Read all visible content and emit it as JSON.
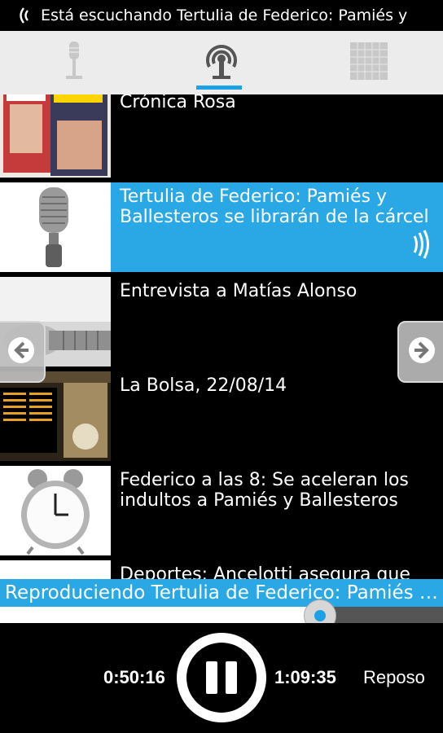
{
  "status": {
    "text": "Está escuchando Tertulia de Federico: Pamiés y",
    "icon": "broadcast-waves-icon"
  },
  "tabs": [
    {
      "name": "microphone-tab",
      "icon": "microphone-icon",
      "selected": false
    },
    {
      "name": "podcast-tab",
      "icon": "podcast-icon",
      "selected": true
    },
    {
      "name": "calendar-tab",
      "icon": "calendar-icon",
      "selected": false
    }
  ],
  "list": {
    "items": [
      {
        "title": "Crónica Rosa",
        "thumb": "magazines"
      },
      {
        "title": "Tertulia de Federico: Pamiés y Ballesteros se librarán de la cárcel",
        "thumb": "microphone",
        "active": true
      },
      {
        "title": "Entrevista a Matías Alonso",
        "thumb": "microphone-side"
      },
      {
        "title": "La Bolsa, 22/08/14",
        "thumb": "stock-board"
      },
      {
        "title": "Federico a las 8: Se aceleran los indultos a Pamiés y Ballesteros",
        "thumb": "alarm-clock"
      },
      {
        "title": "Deportes: Ancelotti asegura que Di",
        "thumb": "white"
      }
    ]
  },
  "player": {
    "now_playing": "Reproduciendo Tertulia de Federico: Pamiés y Ballesteros se librarán de la cárcel",
    "elapsed": "0:50:16",
    "total": "1:09:35",
    "sleep_label": "Reposo",
    "progress_fraction": 0.722
  },
  "colors": {
    "accent": "#2aa8e6",
    "tab_bg": "#ececec",
    "background": "#000000"
  }
}
